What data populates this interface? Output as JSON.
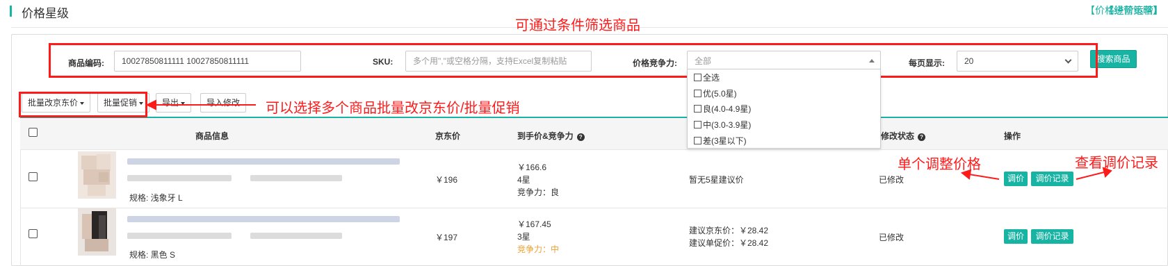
{
  "header": {
    "title": "价格星级",
    "links": [
      "【价格进阶运营】",
      "【经营策略】"
    ]
  },
  "filters": {
    "product_code": {
      "label": "商品编码:",
      "value": "10027850811111  10027850811111"
    },
    "sku": {
      "label": "SKU:",
      "placeholder": "多个用\",\"或空格分隔，支持Excel复制粘贴"
    },
    "competitiveness": {
      "label": "价格竞争力:",
      "placeholder": "全部",
      "options": [
        "全选",
        "优(5.0星)",
        "良(4.0-4.9星)",
        "中(3.0-3.9星)",
        "差(3星以下)"
      ]
    },
    "page_size": {
      "label": "每页显示:",
      "value": "20"
    },
    "search_label": "搜索商品"
  },
  "toolbar": {
    "batch_price": "批量改京东价",
    "batch_promo": "批量促销",
    "export": "导出",
    "import": "导入修改"
  },
  "table": {
    "columns": [
      "商品信息",
      "京东价",
      "到手价&竞争力",
      "修改状态",
      "操作"
    ],
    "rows": [
      {
        "spec": "规格: 浅象牙 L",
        "jd_price": "￥196",
        "final_price": "￥166.6",
        "stars": "4星",
        "competitiveness": "竞争力：良",
        "suggestion_1": "暂无5星建议价",
        "suggestion_2": "",
        "status": "已修改",
        "btn_adjust": "调价",
        "btn_history": "调价记录"
      },
      {
        "spec": "规格: 黑色 S",
        "jd_price": "￥197",
        "final_price": "￥167.45",
        "stars": "3星",
        "competitiveness": "竞争力：中",
        "suggestion_1": "建议京东价：￥28.42",
        "suggestion_2": "建议单促价：￥28.42",
        "status": "已修改",
        "btn_adjust": "调价",
        "btn_history": "调价记录"
      }
    ]
  },
  "annotations": {
    "filter_note": "可通过条件筛选商品",
    "batch_note": "可以选择多个商品批量改京东价/批量促销",
    "adjust_note": "单个调整价格",
    "history_note": "查看调价记录"
  },
  "colors": {
    "accent": "#17b3a3",
    "annotation_red": "#ff1a1a",
    "competitive_mid": "#f0a030"
  }
}
